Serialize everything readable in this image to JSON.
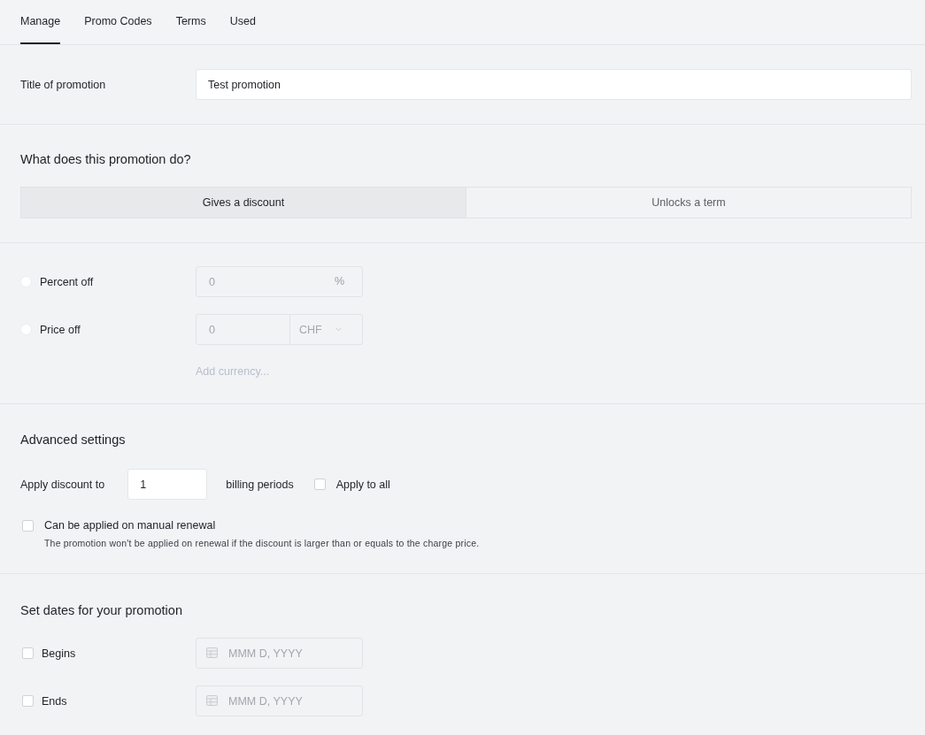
{
  "tabs": [
    {
      "label": "Manage",
      "selected": true
    },
    {
      "label": "Promo Codes",
      "selected": false
    },
    {
      "label": "Terms",
      "selected": false
    },
    {
      "label": "Used",
      "selected": false
    }
  ],
  "title_field": {
    "label": "Title of promotion",
    "value": "Test promotion"
  },
  "promotion_type": {
    "heading": "What does this promotion do?",
    "options": [
      {
        "label": "Gives a discount",
        "selected": true
      },
      {
        "label": "Unlocks a term",
        "selected": false
      }
    ]
  },
  "discount": {
    "options": [
      {
        "kind": "percent",
        "label": "Percent off",
        "selected": false,
        "disabled": true,
        "placeholder": "0",
        "unit": "%"
      },
      {
        "kind": "price",
        "label": "Price off",
        "selected": false,
        "disabled": true,
        "placeholder": "0",
        "currency": "CHF"
      }
    ],
    "add_currency_link": "Add currency..."
  },
  "advanced": {
    "heading": "Advanced settings",
    "apply_label": "Apply discount to",
    "periods_value": "1",
    "periods_suffix": "billing periods",
    "apply_to_all": {
      "label": "Apply to all",
      "checked": false
    },
    "manual_renewal": {
      "label": "Can be applied on manual renewal",
      "checked": false,
      "hint": "The promotion won't be applied on renewal if the discount is larger than or equals to the charge price."
    }
  },
  "dates": {
    "heading": "Set dates for your promotion",
    "rows": [
      {
        "label": "Begins",
        "checked": false,
        "disabled": true,
        "placeholder": "MMM D, YYYY"
      },
      {
        "label": "Ends",
        "checked": false,
        "disabled": true,
        "placeholder": "MMM D, YYYY"
      }
    ]
  }
}
